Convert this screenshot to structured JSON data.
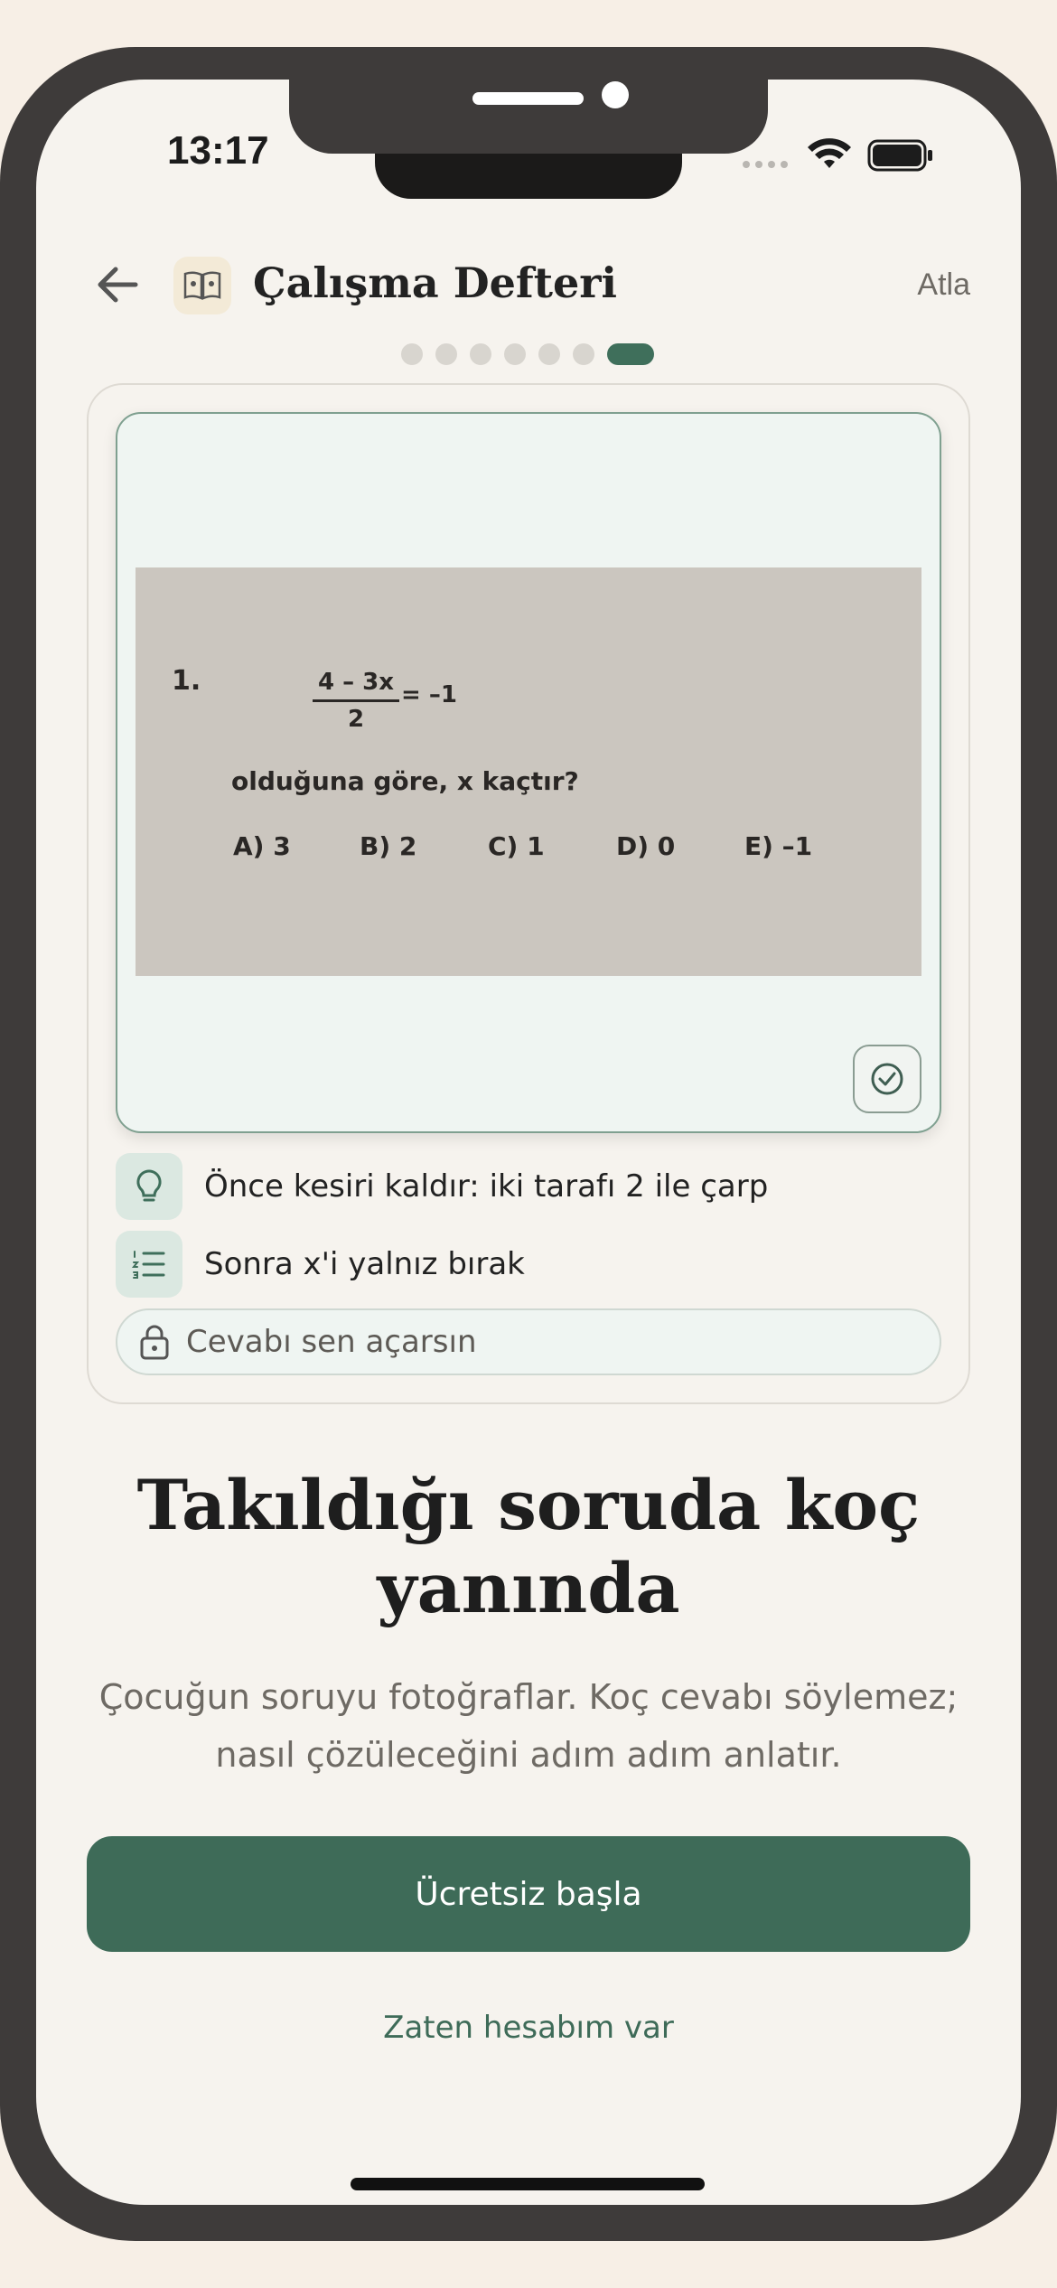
{
  "status_bar": {
    "time": "13:17"
  },
  "header": {
    "title": "Çalışma Defteri",
    "skip_label": "Atla",
    "progress": {
      "total_steps": 7,
      "current_step": 7
    }
  },
  "question_photo": {
    "number": "1.",
    "fraction_numerator": "4 – 3x",
    "fraction_denominator": "2",
    "equation_rhs": "= –1",
    "prompt": "olduğuna göre,  x  kaçtır?",
    "options": [
      "A) 3",
      "B) 2",
      "C) 1",
      "D) 0",
      "E) –1"
    ]
  },
  "hints": [
    {
      "icon": "lightbulb-icon",
      "text": "Önce kesiri kaldır: iki tarafı 2 ile çarp"
    },
    {
      "icon": "numbered-list-icon",
      "text": "Sonra x'i yalnız bırak"
    }
  ],
  "answer_lock": {
    "icon": "lock-icon",
    "text": "Cevabı sen açarsın"
  },
  "headline": "Takıldığı soruda koç yanında",
  "subtext": "Çocuğun soruyu fotoğraflar. Koç cevabı söylemez; nasıl çözüleceğini adım adım anlatır.",
  "primary_button": "Ücretsiz başla",
  "secondary_link": "Zaten hesabım var",
  "colors": {
    "accent": "#3e6b58",
    "background": "#f6f3ee",
    "frame": "#3e3b3a"
  }
}
